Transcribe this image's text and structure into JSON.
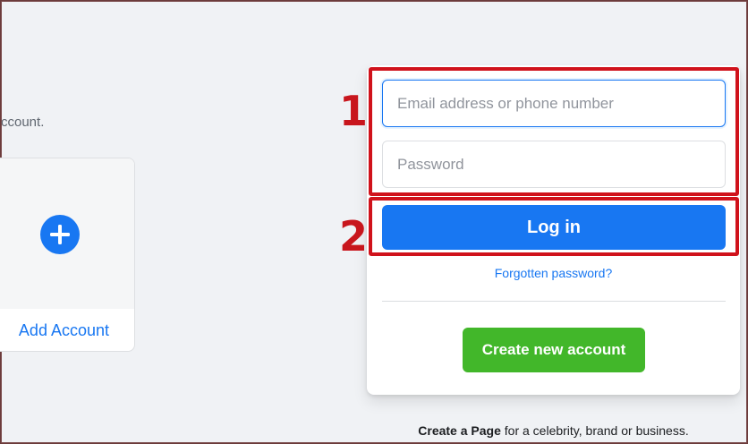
{
  "left_panel": {
    "hint_text": "ccount.",
    "add_account_label": "Add Account"
  },
  "login_form": {
    "email_placeholder": "Email address or phone number",
    "password_placeholder": "Password",
    "login_label": "Log in",
    "forgot_label": "Forgotten password?",
    "create_account_label": "Create new account"
  },
  "footer": {
    "create_page_bold": "Create a Page",
    "create_page_rest": " for a celebrity, brand or business."
  },
  "annotations": {
    "label_1": "1",
    "label_2": "2"
  },
  "colors": {
    "brand_blue": "#1877f2",
    "create_green": "#42b72a",
    "annotation_red": "#d0121b",
    "page_bg": "#f0f2f5"
  },
  "icons": {
    "add_account": "plus-circle-icon"
  }
}
